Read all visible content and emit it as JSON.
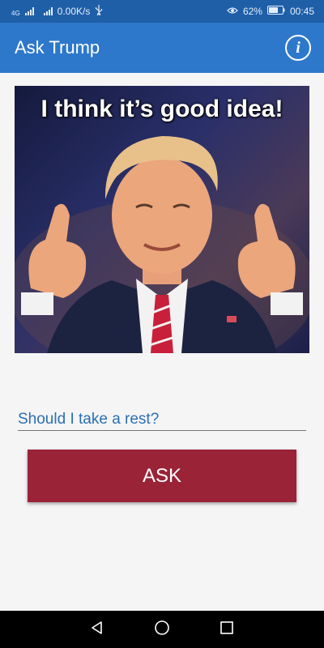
{
  "status": {
    "network_type": "4G",
    "speed": "0.00K/s",
    "battery": "62%",
    "time": "00:45"
  },
  "appbar": {
    "title": "Ask Trump"
  },
  "answer": {
    "caption": "I think it’s good idea!"
  },
  "question": {
    "value": "Should I take a rest?"
  },
  "ask_button": {
    "label": "ASK"
  },
  "colors": {
    "status_bar": "#1f5fa8",
    "app_bar": "#2d78cb",
    "ask_button": "#9a2337",
    "question_text": "#2b6fb4"
  }
}
